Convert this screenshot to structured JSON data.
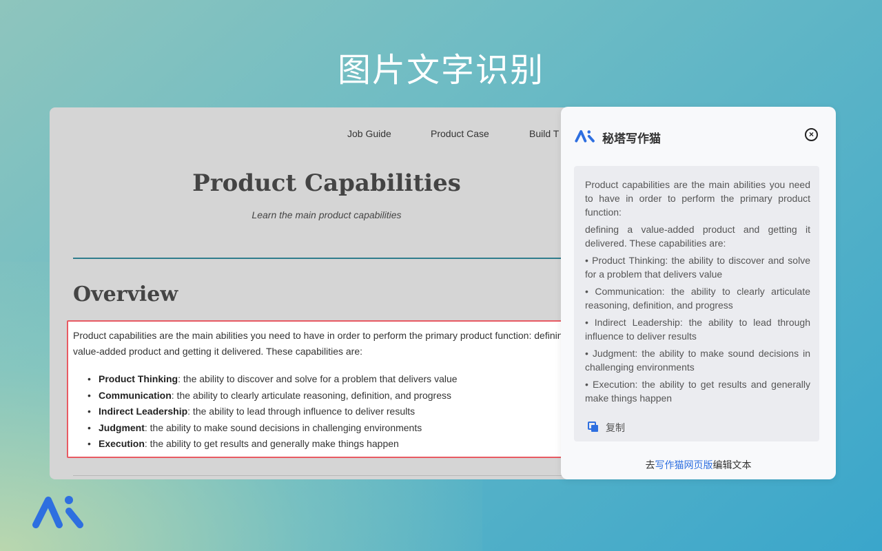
{
  "hero": {
    "title": "图片文字识别"
  },
  "page": {
    "nav": [
      "Job Guide",
      "Product Case",
      "Build T"
    ],
    "title": "Product Capabilities",
    "subtitle": "Learn the main product capabilities",
    "section_heading": "Overview",
    "selection": {
      "paragraph": "Product capabilities are the main abilities you need to have in order to perform the primary product function: defining a value-added product and getting it delivered. These capabilities are:",
      "items": [
        {
          "term": "Product Thinking",
          "desc": ": the ability to discover and solve for a problem that delivers value"
        },
        {
          "term": "Communication",
          "desc": ": the ability to clearly articulate reasoning, definition, and progress"
        },
        {
          "term": "Indirect Leadership",
          "desc": ": the ability to lead through influence to deliver results"
        },
        {
          "term": "Judgment",
          "desc": ": the ability to make sound decisions in challenging environments"
        },
        {
          "term": "Execution",
          "desc": ": the ability to get results and generally make things happen"
        }
      ]
    }
  },
  "panel": {
    "title": "秘塔写作猫",
    "close_icon": "close-icon",
    "result_paragraphs": [
      "Product capabilities are the main abilities you need to have in order to perform the primary product function:",
      "defining a value-added product and getting it delivered. These capabilities are:",
      "• Product Thinking: the ability to discover and solve for a problem that delivers value",
      "• Communication: the ability to clearly articulate reasoning, definition, and progress",
      "• Indirect Leadership: the ability to lead through influence to deliver results",
      "• Judgment: the ability to make sound decisions in challenging environments",
      "• Execution: the ability to get results and generally make things happen"
    ],
    "copy_label": "复制",
    "footer": {
      "prefix": "去",
      "link": "写作猫网页版",
      "suffix": "编辑文本"
    }
  },
  "colors": {
    "brand_blue": "#2e6fe0",
    "selection_border": "#e85a62",
    "divider": "#2f7d8c"
  }
}
